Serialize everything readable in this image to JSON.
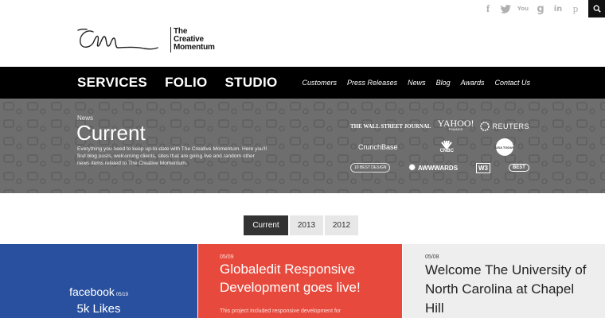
{
  "social": {
    "icons": [
      {
        "name": "facebook-icon",
        "glyph": "f"
      },
      {
        "name": "twitter-icon",
        "glyph": "🐦"
      },
      {
        "name": "youtube-icon",
        "glyph": "You"
      },
      {
        "name": "google-plus-icon",
        "glyph": "g"
      },
      {
        "name": "linkedin-icon",
        "glyph": "in"
      },
      {
        "name": "pinterest-icon",
        "glyph": "p"
      }
    ],
    "search_icon": "search-icon"
  },
  "logo": {
    "line1": "The",
    "line2": "Creative",
    "line3": "Momentum"
  },
  "nav": {
    "main": [
      "SERVICES",
      "FOLIO",
      "STUDIO"
    ],
    "sub": [
      "Customers",
      "Press Releases",
      "News",
      "Blog",
      "Awards",
      "Contact Us"
    ]
  },
  "hero": {
    "kicker": "News",
    "title": "Current",
    "description": "Everything you need to keep up-to-date with The Creative Momentum. Here you'll find blog posts, welcoming clients, sites that are going live and random other news items related to The Creative Momentum.",
    "press_logos": {
      "wsj": "THE WALL STREET JOURNAL",
      "yahoo": "YAHOO!",
      "yahoo_sub": "FINANCE",
      "reuters": "REUTERS",
      "crunchbase": "CrunchBase",
      "cnbc": "CNBC",
      "usatoday": "USA TODAY",
      "best_design": "10 BEST DESIGN",
      "awwwards": "AWWWARDS",
      "w3": "W3",
      "best_web": "BEST"
    }
  },
  "tabs": {
    "current": "Current",
    "y2013": "2013",
    "y2012": "2012"
  },
  "cards": {
    "facebook": {
      "label": "facebook",
      "date": "05/19",
      "likes": "5k Likes"
    },
    "red": {
      "date": "05/09",
      "title": "Globaledit Responsive Development goes live!",
      "body": "This project included responsive development for"
    },
    "white": {
      "date": "05/08",
      "title": "Welcome The University of North Carolina at Chapel Hill"
    }
  },
  "colors": {
    "nav_bg": "#000000",
    "hero_bg": "#6e6e6e",
    "facebook_blue": "#29509e",
    "red": "#e74a3d",
    "light_gray": "#eeeeee"
  }
}
